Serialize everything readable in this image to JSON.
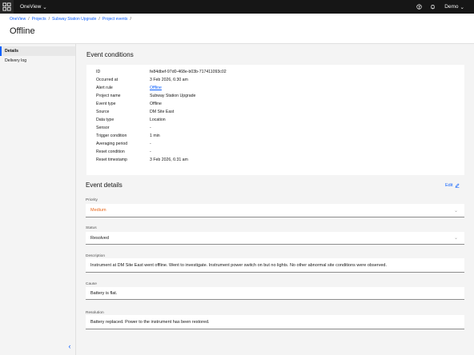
{
  "topbar": {
    "app_name": "OneView",
    "user_name": "Demo",
    "help_icon": "help-icon",
    "notification_icon": "notification-icon"
  },
  "header": {
    "breadcrumb": [
      "OneView",
      "Projects",
      "Subway Station Upgrade",
      "Project events"
    ],
    "title": "Offline"
  },
  "sidebar": {
    "items": [
      {
        "label": "Details",
        "active": true
      },
      {
        "label": "Delivery log",
        "active": false
      }
    ]
  },
  "event_conditions": {
    "title": "Event conditions",
    "rows": [
      {
        "label": "ID",
        "value": "fe84dbef-97d0-468e-b03b-717411093c02",
        "link": false
      },
      {
        "label": "Occurred at",
        "value": "3 Feb 2026, 6:30 am",
        "link": false
      },
      {
        "label": "Alert rule",
        "value": "Offline",
        "link": true
      },
      {
        "label": "Project name",
        "value": "Subway Station Upgrade",
        "link": false
      },
      {
        "label": "Event type",
        "value": "Offline",
        "link": false
      },
      {
        "label": "Source",
        "value": "DM Site East",
        "link": false
      },
      {
        "label": "Data type",
        "value": "Location",
        "link": false
      },
      {
        "label": "Sensor",
        "value": "-",
        "link": false
      },
      {
        "label": "Trigger condition",
        "value": "1 min",
        "link": false
      },
      {
        "label": "Averaging period",
        "value": "-",
        "link": false
      },
      {
        "label": "Reset condition",
        "value": "-",
        "link": false
      },
      {
        "label": "Reset timestamp",
        "value": "3 Feb 2026, 6:31 am",
        "link": false
      }
    ]
  },
  "event_details": {
    "title": "Event details",
    "edit_label": "Edit",
    "priority": {
      "label": "Priority",
      "value": "Medium",
      "color": "#e8671a"
    },
    "status": {
      "label": "Status",
      "value": "Resolved"
    },
    "description": {
      "label": "Description",
      "value": "Instrument at DM Site East went offline. Went to investigate. Instrument power switch on but no lights. No other abnormal site conditions were observed."
    },
    "cause": {
      "label": "Cause",
      "value": "Battery is flat."
    },
    "resolution": {
      "label": "Resolution",
      "value": "Battery replaced. Power to the instrument has been restored."
    }
  },
  "colors": {
    "accent": "#0f62fe",
    "topbar_bg": "#161616",
    "priority_medium": "#e8671a"
  }
}
